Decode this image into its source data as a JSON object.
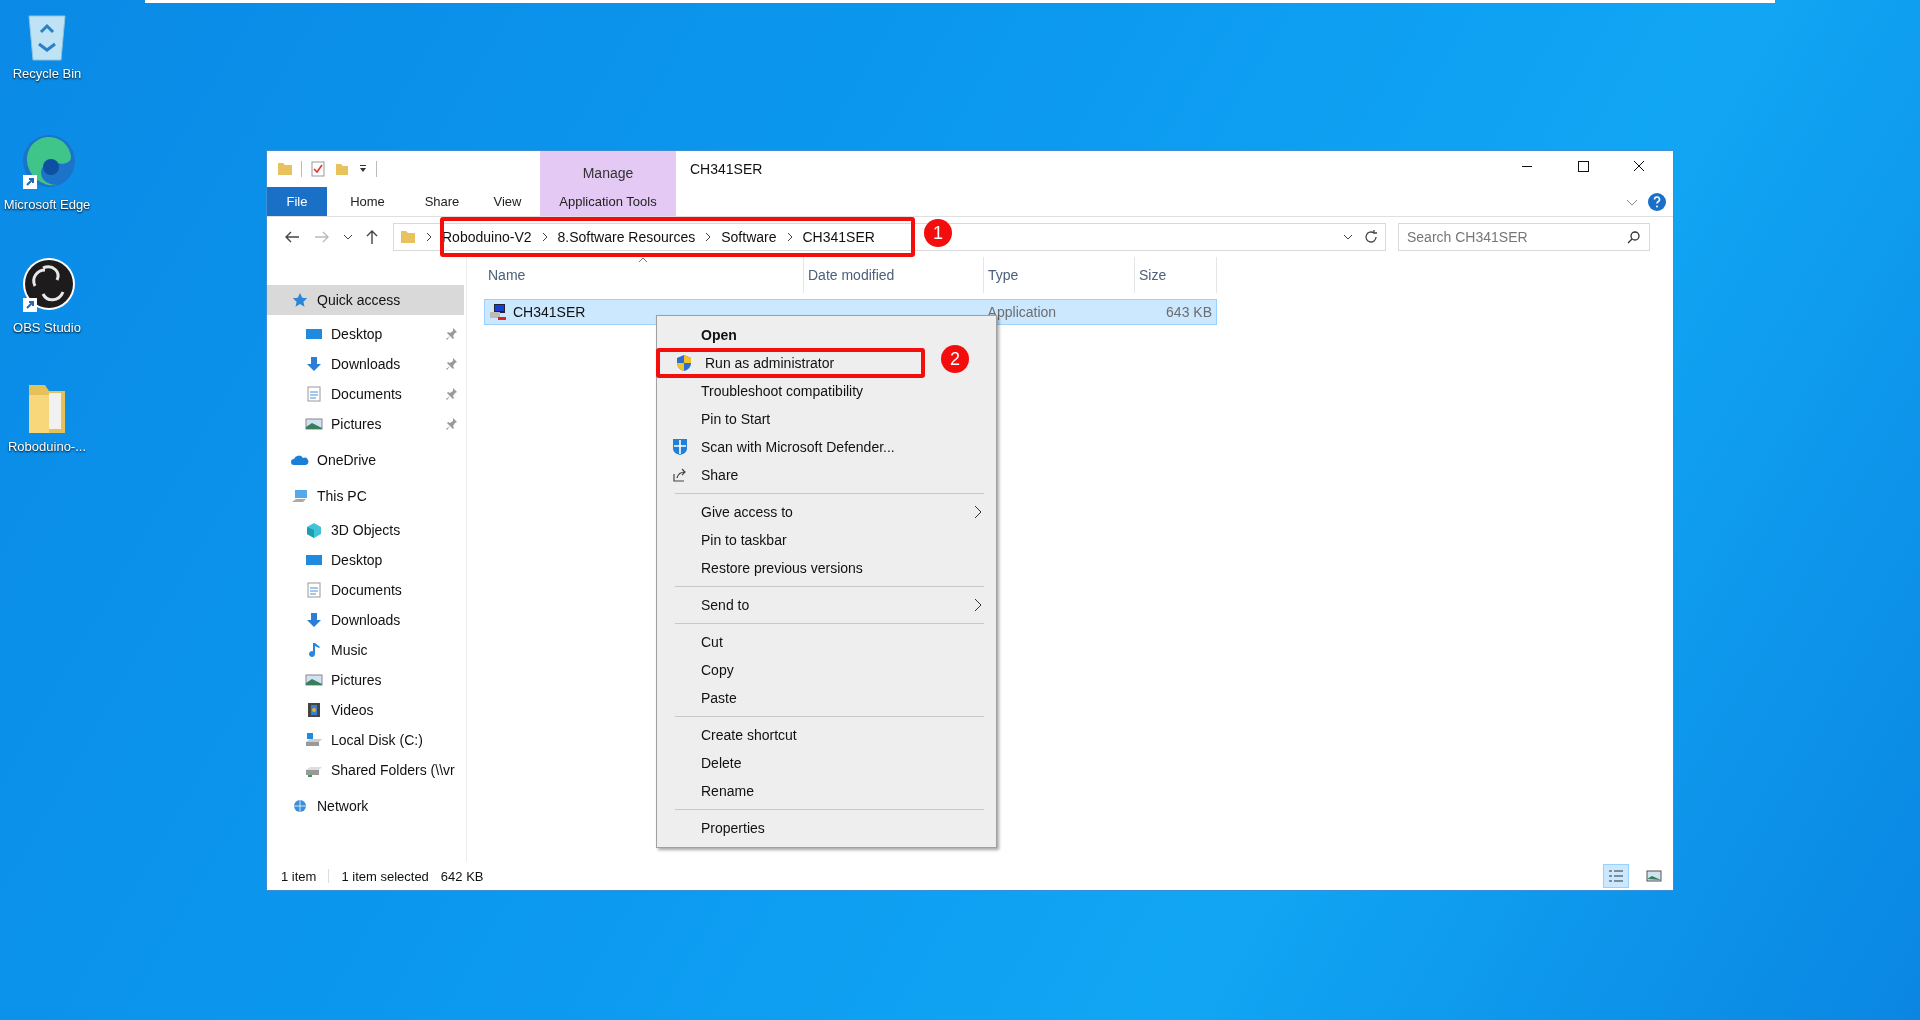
{
  "desktop_icons": [
    {
      "label": "Recycle Bin",
      "kind": "recycle"
    },
    {
      "label": "Microsoft Edge",
      "kind": "edge"
    },
    {
      "label": "OBS Studio",
      "kind": "obs"
    },
    {
      "label": "Roboduino-...",
      "kind": "folder"
    }
  ],
  "window": {
    "title": "CH341SER",
    "context_group": "Manage",
    "ribbon_tabs": [
      {
        "label": "File",
        "kind": "file"
      },
      {
        "label": "Home",
        "kind": "normal"
      },
      {
        "label": "Share",
        "kind": "normal"
      },
      {
        "label": "View",
        "kind": "normal"
      },
      {
        "label": "Application Tools",
        "kind": "context"
      }
    ],
    "breadcrumbs": [
      "Roboduino-V2",
      "8.Software Resources",
      "Software",
      "CH341SER"
    ],
    "search": {
      "placeholder": "Search CH341SER"
    },
    "nav_pane": [
      {
        "label": "Quick access",
        "kind": "star",
        "selected": true,
        "children": [
          {
            "label": "Desktop",
            "kind": "desktop",
            "pinned": true
          },
          {
            "label": "Downloads",
            "kind": "download",
            "pinned": true
          },
          {
            "label": "Documents",
            "kind": "document",
            "pinned": true
          },
          {
            "label": "Pictures",
            "kind": "pictures",
            "pinned": true
          }
        ]
      },
      {
        "label": "OneDrive",
        "kind": "cloud",
        "selected": false
      },
      {
        "label": "This PC",
        "kind": "pc",
        "selected": false,
        "children": [
          {
            "label": "3D Objects",
            "kind": "cube",
            "pinned": false
          },
          {
            "label": "Desktop",
            "kind": "desktop",
            "pinned": false
          },
          {
            "label": "Documents",
            "kind": "document",
            "pinned": false
          },
          {
            "label": "Downloads",
            "kind": "download",
            "pinned": false
          },
          {
            "label": "Music",
            "kind": "music",
            "pinned": false
          },
          {
            "label": "Pictures",
            "kind": "pictures",
            "pinned": false
          },
          {
            "label": "Videos",
            "kind": "video",
            "pinned": false
          },
          {
            "label": "Local Disk (C:)",
            "kind": "disk",
            "pinned": false
          },
          {
            "label": "Shared Folders (\\\\vr",
            "kind": "share-drive",
            "pinned": false
          }
        ]
      },
      {
        "label": "Network",
        "kind": "network",
        "selected": false
      }
    ],
    "columns": [
      {
        "label": "Name",
        "sorted": true
      },
      {
        "label": "Date modified",
        "sorted": false
      },
      {
        "label": "Type",
        "sorted": false
      },
      {
        "label": "Size",
        "sorted": false
      }
    ],
    "files": [
      {
        "name": "CH341SER",
        "type": "Application",
        "size": "643 KB",
        "selected": true
      }
    ],
    "status_bar": {
      "items": "1 item",
      "selection": "1 item selected",
      "size": "642 KB",
      "views": [
        {
          "kind": "details",
          "selected": true
        },
        {
          "kind": "large-icons",
          "selected": false
        }
      ]
    }
  },
  "context_menu": [
    {
      "kind": "item",
      "label": "Open",
      "default": true
    },
    {
      "kind": "shield",
      "label": "Run as administrator"
    },
    {
      "kind": "item",
      "label": "Troubleshoot compatibility"
    },
    {
      "kind": "item",
      "label": "Pin to Start"
    },
    {
      "kind": "defender",
      "label": "Scan with Microsoft Defender..."
    },
    {
      "kind": "share",
      "label": "Share"
    },
    {
      "kind": "separator"
    },
    {
      "kind": "item",
      "label": "Give access to",
      "submenu": true
    },
    {
      "kind": "item",
      "label": "Pin to taskbar"
    },
    {
      "kind": "item",
      "label": "Restore previous versions"
    },
    {
      "kind": "separator"
    },
    {
      "kind": "item",
      "label": "Send to",
      "submenu": true
    },
    {
      "kind": "separator"
    },
    {
      "kind": "item",
      "label": "Cut"
    },
    {
      "kind": "item",
      "label": "Copy"
    },
    {
      "kind": "item",
      "label": "Paste"
    },
    {
      "kind": "separator"
    },
    {
      "kind": "item",
      "label": "Create shortcut"
    },
    {
      "kind": "item",
      "label": "Delete"
    },
    {
      "kind": "item",
      "label": "Rename"
    },
    {
      "kind": "separator"
    },
    {
      "kind": "item",
      "label": "Properties"
    }
  ],
  "callouts": [
    {
      "number": "1"
    },
    {
      "number": "2"
    }
  ]
}
